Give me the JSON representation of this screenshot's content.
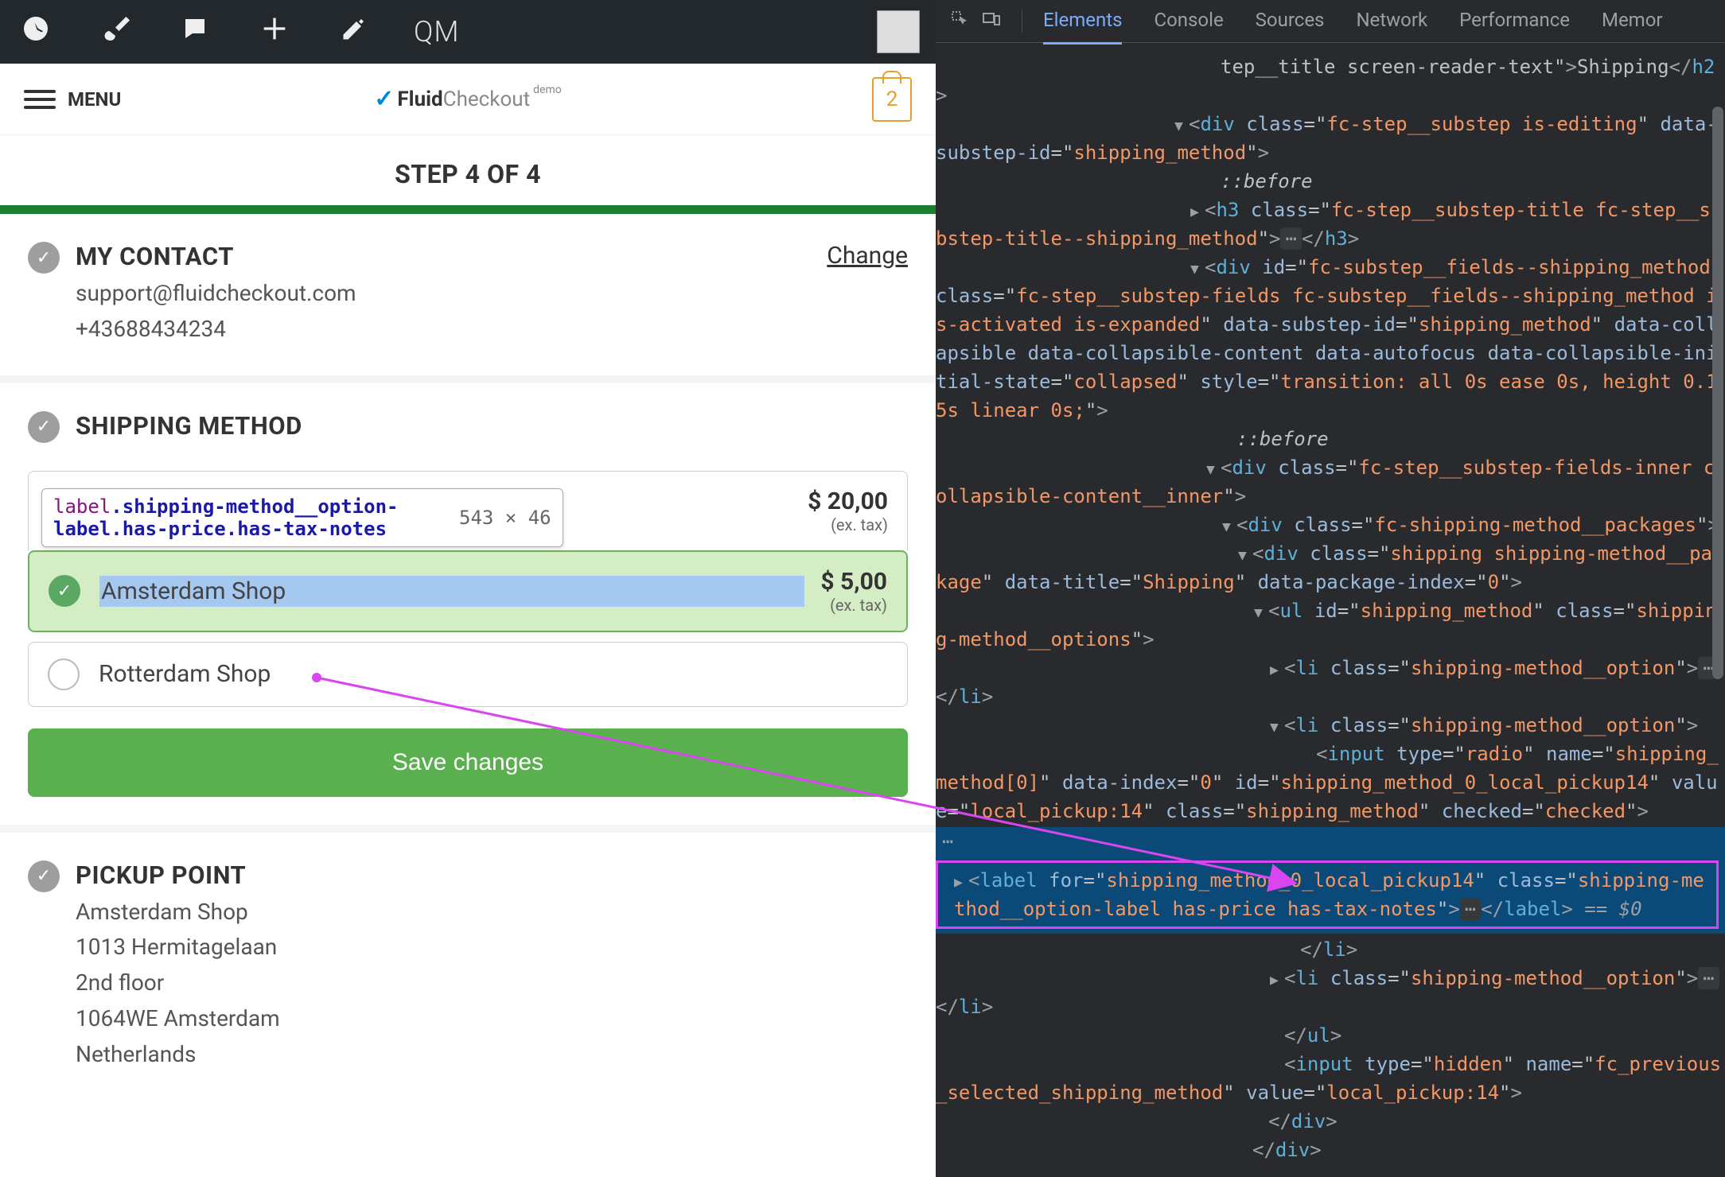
{
  "adminBar": {
    "qm_label": "QM"
  },
  "header": {
    "menu_label": "MENU",
    "logo_prefix": "Fluid",
    "logo_suffix": "Checkout",
    "logo_demo": "demo",
    "cart_count": "2"
  },
  "step": {
    "title": "STEP 4 OF 4"
  },
  "contact": {
    "title": "MY CONTACT",
    "email": "support@fluidcheckout.com",
    "phone": "+43688434234",
    "change_label": "Change"
  },
  "shipping": {
    "title": "SHIPPING METHOD",
    "options": [
      {
        "label": "",
        "price": "$ 20,00",
        "tax": "(ex. tax)"
      },
      {
        "label": "Amsterdam Shop",
        "price": "$ 5,00",
        "tax": "(ex. tax)",
        "selected": true
      },
      {
        "label": "Rotterdam Shop"
      }
    ],
    "save_label": "Save changes"
  },
  "tooltip": {
    "tag": "label",
    "classes": ".shipping-method__option-label.has-price.has-tax-notes",
    "dims": "543 × 46"
  },
  "pickup": {
    "title": "PICKUP POINT",
    "lines": [
      "Amsterdam Shop",
      "1013 Hermitagelaan",
      "2nd floor",
      "1064WE Amsterdam",
      "Netherlands"
    ]
  },
  "devtools": {
    "tabs": [
      "Elements",
      "Console",
      "Sources",
      "Network",
      "Performance",
      "Memor"
    ],
    "active_tab": 0,
    "lines": [
      {
        "indent": 340,
        "html": "tep__title screen-reader-text\"<span class='tag-bracket'>&gt;</span>Shipping<span class='tag-bracket'>&lt;/</span><span class='tag-name'>h2</span><span class='tag-bracket'>&gt;</span>"
      },
      {
        "indent": 300,
        "arrow": "▼",
        "html": "<span class='tag-bracket'>&lt;</span><span class='tag-name'>div</span> <span class='attr-name'>class</span>=\"<span class='attr-val'>fc-step__substep is-editing</span>\" <span class='attr-name'>data-substep-id</span>=\"<span class='attr-val'>shipping_method</span>\"<span class='tag-bracket'>&gt;</span>"
      },
      {
        "indent": 340,
        "html": "<span class='pseudo'>::before</span>"
      },
      {
        "indent": 320,
        "arrow": "▶",
        "html": "<span class='tag-bracket'>&lt;</span><span class='tag-name'>h3</span> <span class='attr-name'>class</span>=\"<span class='attr-val'>fc-step__substep-title fc-step__substep-title--shipping_method</span>\"<span class='tag-bracket'>&gt;</span><span class='ellipsis'>⋯</span><span class='tag-bracket'>&lt;/</span><span class='tag-name'>h3</span><span class='tag-bracket'>&gt;</span>"
      },
      {
        "indent": 320,
        "arrow": "▼",
        "html": "<span class='tag-bracket'>&lt;</span><span class='tag-name'>div</span> <span class='attr-name'>id</span>=\"<span class='attr-val'>fc-substep__fields--shipping_method</span>\" <span class='attr-name'>class</span>=\"<span class='attr-val'>fc-step__substep-fields fc-substep__fields--shipping_method is-activated is-expanded</span>\" <span class='attr-name'>data-substep-id</span>=\"<span class='attr-val'>shipping_method</span>\" <span class='attr-name'>data-collapsible</span> <span class='attr-name'>data-collapsible-content</span> <span class='attr-name'>data-autofocus</span> <span class='attr-name'>data-collapsible-initial-state</span>=\"<span class='attr-val'>collapsed</span>\" <span class='attr-name'>style</span>=\"<span class='attr-val'>transition: all 0s ease 0s, height 0.15s linear 0s;</span>\"<span class='tag-bracket'>&gt;</span>"
      },
      {
        "indent": 360,
        "html": "<span class='pseudo'>::before</span>"
      },
      {
        "indent": 340,
        "arrow": "▼",
        "html": "<span class='tag-bracket'>&lt;</span><span class='tag-name'>div</span> <span class='attr-name'>class</span>=\"<span class='attr-val'>fc-step__substep-fields-inner collapsible-content__inner</span>\"<span class='tag-bracket'>&gt;</span>"
      },
      {
        "indent": 360,
        "arrow": "▼",
        "html": "<span class='tag-bracket'>&lt;</span><span class='tag-name'>div</span> <span class='attr-name'>class</span>=\"<span class='attr-val'>fc-shipping-method__packages</span>\"<span class='tag-bracket'>&gt;</span>"
      },
      {
        "indent": 380,
        "arrow": "▼",
        "html": "<span class='tag-bracket'>&lt;</span><span class='tag-name'>div</span> <span class='attr-name'>class</span>=\"<span class='attr-val'>shipping shipping-method__package</span>\" <span class='attr-name'>data-title</span>=\"<span class='attr-val'>Shipping</span>\" <span class='attr-name'>data-package-index</span>=\"<span class='attr-val'>0</span>\"<span class='tag-bracket'>&gt;</span>"
      },
      {
        "indent": 400,
        "arrow": "▼",
        "html": "<span class='tag-bracket'>&lt;</span><span class='tag-name'>ul</span> <span class='attr-name'>id</span>=\"<span class='attr-val'>shipping_method</span>\" <span class='attr-name'>class</span>=\"<span class='attr-val'>shipping-method__options</span>\"<span class='tag-bracket'>&gt;</span>"
      },
      {
        "indent": 420,
        "arrow": "▶",
        "html": "<span class='tag-bracket'>&lt;</span><span class='tag-name'>li</span> <span class='attr-name'>class</span>=\"<span class='attr-val'>shipping-method__option</span>\"<span class='tag-bracket'>&gt;</span><span class='ellipsis'>⋯</span><span class='tag-bracket'>&lt;/</span><span class='tag-name'>li</span><span class='tag-bracket'>&gt;</span>"
      },
      {
        "indent": 420,
        "arrow": "▼",
        "html": "<span class='tag-bracket'>&lt;</span><span class='tag-name'>li</span> <span class='attr-name'>class</span>=\"<span class='attr-val'>shipping-method__option</span>\"<span class='tag-bracket'>&gt;</span>"
      },
      {
        "indent": 460,
        "html": "<span class='tag-bracket'>&lt;</span><span class='tag-name'>input</span> <span class='attr-name'>type</span>=\"<span class='attr-val'>radio</span>\" <span class='attr-name'>name</span>=\"<span class='attr-val'>shipping_method[0]</span>\" <span class='attr-name'>data-index</span>=\"<span class='attr-val'>0</span>\" <span class='attr-name'>id</span>=\"<span class='attr-val'>shipping_method_0_local_pickup14</span>\" <span class='attr-name'>value</span>=\"<span class='attr-val'>local_pickup:14</span>\" <span class='attr-name'>class</span>=\"<span class='attr-val'>shipping_method</span>\" <span class='attr-name'>checked</span>=\"<span class='attr-val'>checked</span>\"<span class='tag-bracket'>&gt;</span>"
      },
      {
        "indent": 440,
        "arrow": "▶",
        "highlight": true,
        "magenta": true,
        "html": "<span class='tag-bracket'>&lt;</span><span class='tag-name'>label</span> <span class='attr-name'>for</span>=\"<span class='attr-val'>shipping_method_0_local_pickup14</span>\" <span class='attr-name'>class</span>=\"<span class='attr-val'>shipping-method__option-label has-price has-tax-notes</span>\"<span class='tag-bracket'>&gt;</span><span class='ellipsis'>⋯</span><span class='tag-bracket'>&lt;/</span><span class='tag-name'>label</span><span class='tag-bracket'>&gt;</span> <span class='var'>== $0</span>"
      },
      {
        "indent": 440,
        "html": "<span class='tag-bracket'>&lt;/</span><span class='tag-name'>li</span><span class='tag-bracket'>&gt;</span>"
      },
      {
        "indent": 420,
        "arrow": "▶",
        "html": "<span class='tag-bracket'>&lt;</span><span class='tag-name'>li</span> <span class='attr-name'>class</span>=\"<span class='attr-val'>shipping-method__option</span>\"<span class='tag-bracket'>&gt;</span><span class='ellipsis'>⋯</span><span class='tag-bracket'>&lt;/</span><span class='tag-name'>li</span><span class='tag-bracket'>&gt;</span>"
      },
      {
        "indent": 420,
        "html": "<span class='tag-bracket'>&lt;/</span><span class='tag-name'>ul</span><span class='tag-bracket'>&gt;</span>"
      },
      {
        "indent": 420,
        "html": "<span class='tag-bracket'>&lt;</span><span class='tag-name'>input</span> <span class='attr-name'>type</span>=\"<span class='attr-val'>hidden</span>\" <span class='attr-name'>name</span>=\"<span class='attr-val'>fc_previous_selected_shipping_method</span>\" <span class='attr-name'>value</span>=\"<span class='attr-val'>local_pickup:14</span>\"<span class='tag-bracket'>&gt;</span>"
      },
      {
        "indent": 400,
        "html": "<span class='tag-bracket'>&lt;/</span><span class='tag-name'>div</span><span class='tag-bracket'>&gt;</span>"
      },
      {
        "indent": 380,
        "html": "<span class='tag-bracket'>&lt;/</span><span class='tag-name'>div</span><span class='tag-bracket'>&gt;</span>"
      }
    ]
  },
  "annotation": {
    "color": "#d946ef"
  }
}
